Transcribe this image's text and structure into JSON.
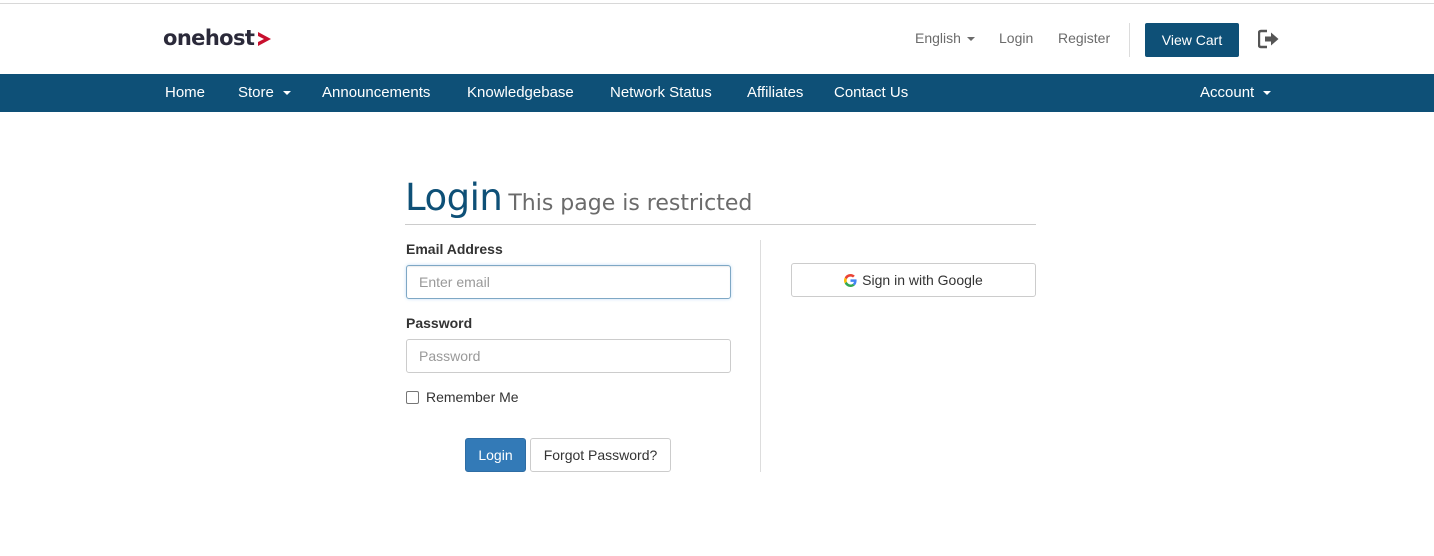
{
  "brand": {
    "name": "onehost",
    "accent": "#c8102e"
  },
  "topbar": {
    "language": "English",
    "login": "Login",
    "register": "Register",
    "view_cart": "View Cart",
    "logout_icon": "sign-out-icon"
  },
  "nav": {
    "items": [
      {
        "label": "Home"
      },
      {
        "label": "Store"
      },
      {
        "label": "Announcements"
      },
      {
        "label": "Knowledgebase"
      },
      {
        "label": "Network Status"
      },
      {
        "label": "Affiliates"
      },
      {
        "label": "Contact Us"
      }
    ],
    "account": "Account",
    "color": "#0e5077"
  },
  "page": {
    "title": "Login",
    "subtitle": "This page is restricted"
  },
  "form": {
    "email_label": "Email Address",
    "email_placeholder": "Enter email",
    "email_value": "",
    "password_label": "Password",
    "password_placeholder": "Password",
    "password_value": "",
    "remember_label": "Remember Me",
    "remember_checked": false,
    "login_button": "Login",
    "forgot_button": "Forgot Password?"
  },
  "social": {
    "google_button": "Sign in with Google",
    "google_icon": "google-icon"
  }
}
